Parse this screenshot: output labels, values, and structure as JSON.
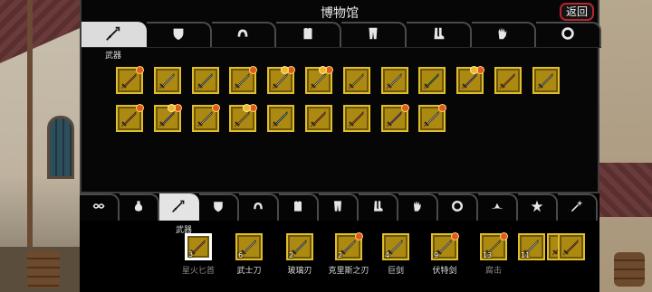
{
  "panel": {
    "title": "博物馆",
    "back_label": "返回"
  },
  "top_tabs": [
    {
      "icon": "sword-icon",
      "active": true
    },
    {
      "icon": "shield-icon",
      "active": false
    },
    {
      "icon": "helmet-icon",
      "active": false
    },
    {
      "icon": "armor-icon",
      "active": false
    },
    {
      "icon": "pants-icon",
      "active": false
    },
    {
      "icon": "boots-icon",
      "active": false
    },
    {
      "icon": "gloves-icon",
      "active": false
    },
    {
      "icon": "ring-icon",
      "active": false
    }
  ],
  "category_label": "武器",
  "museum_items": [
    {
      "color": "#e8591f",
      "gem": true,
      "gem2": false
    },
    {
      "color": "#cfd6da",
      "gem": false,
      "gem2": false
    },
    {
      "color": "#8fb8c6",
      "gem": false,
      "gem2": false
    },
    {
      "color": "#d9d2c2",
      "gem": true,
      "gem2": false
    },
    {
      "color": "#d6d2cb",
      "gem": true,
      "gem2": true
    },
    {
      "color": "#e6dfc8",
      "gem": true,
      "gem2": true
    },
    {
      "color": "#f3c533",
      "gem": false,
      "gem2": false
    },
    {
      "color": "#cfd6da",
      "gem": false,
      "gem2": false
    },
    {
      "color": "#38a343",
      "gem": false,
      "gem2": false
    },
    {
      "color": "#9b67c7",
      "gem": true,
      "gem2": true
    },
    {
      "color": "#e8591f",
      "gem": false,
      "gem2": false
    },
    {
      "color": "#b7bfc2",
      "gem": false,
      "gem2": false
    },
    {
      "color": "#e8591f",
      "gem": true,
      "gem2": false
    },
    {
      "color": "#a07ad0",
      "gem": true,
      "gem2": true
    },
    {
      "color": "#d8d8d8",
      "gem": true,
      "gem2": false
    },
    {
      "color": "#f3c533",
      "gem": true,
      "gem2": true
    },
    {
      "color": "#62c3e8",
      "gem": false,
      "gem2": false
    },
    {
      "color": "#e8591f",
      "gem": false,
      "gem2": false
    },
    {
      "color": "#e8591f",
      "gem": false,
      "gem2": false
    },
    {
      "color": "#a04ccc",
      "gem": true,
      "gem2": false
    },
    {
      "color": "#e4e4e4",
      "gem": true,
      "gem2": false
    }
  ],
  "bottom_tabs": [
    {
      "icon": "infinity-icon",
      "active": false
    },
    {
      "icon": "potion-icon",
      "active": false
    },
    {
      "icon": "sword-icon",
      "active": true
    },
    {
      "icon": "shield-icon",
      "active": false
    },
    {
      "icon": "helmet-icon",
      "active": false
    },
    {
      "icon": "armor-icon",
      "active": false
    },
    {
      "icon": "pants-icon",
      "active": false
    },
    {
      "icon": "boots-icon",
      "active": false
    },
    {
      "icon": "gloves-icon",
      "active": false
    },
    {
      "icon": "ring-icon",
      "active": false
    },
    {
      "icon": "hat-icon",
      "active": false
    },
    {
      "icon": "star-icon",
      "active": false
    },
    {
      "icon": "wand-icon",
      "active": false
    }
  ],
  "bottom_category_label": "武器",
  "inventory": [
    {
      "count": "3",
      "name": "星火匕首",
      "color": "#e8591f",
      "selected": true,
      "dim": true,
      "gem": false
    },
    {
      "count": "6",
      "name": "武士刀",
      "color": "#d9d2c2",
      "selected": false,
      "dim": false,
      "gem": false
    },
    {
      "count": "2",
      "name": "玻璃刃",
      "color": "#8fb8c6",
      "selected": false,
      "dim": false,
      "gem": false
    },
    {
      "count": "2",
      "name": "克里斯之刃",
      "color": "#d9d2c2",
      "selected": false,
      "dim": false,
      "gem": true
    },
    {
      "count": "4",
      "name": "巨剑",
      "color": "#e6e6e6",
      "selected": false,
      "dim": false,
      "gem": false
    },
    {
      "count": "9",
      "name": "伏特剑",
      "color": "#e6dfc8",
      "selected": false,
      "dim": false,
      "gem": true
    },
    {
      "count": "13",
      "name": "腐击",
      "color": "#f3c533",
      "selected": false,
      "dim": true,
      "gem": true
    },
    {
      "count": "11",
      "name": "",
      "color": "#e6e6e6",
      "selected": false,
      "dim": false,
      "gem": false
    }
  ]
}
